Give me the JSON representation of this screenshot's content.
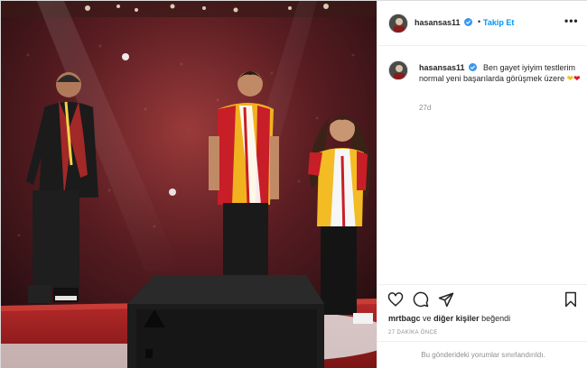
{
  "post": {
    "photo_alt": "hasansas11 post photo",
    "header": {
      "username": "hasansas11",
      "dot": "•",
      "follow_label": "Takip Et",
      "more_label": "•••"
    },
    "caption": {
      "username": "hasansas11",
      "text": "Ben gayet iyiyim testlerim normal yeni başarılarda görüşmek üzere",
      "hearts": [
        "yellow-heart",
        "red-heart"
      ],
      "age": "27d"
    },
    "likes": {
      "user": "mrtbagc",
      "connector": "ve",
      "others": "diğer kişiler",
      "suffix": "beğendi"
    },
    "timestamp": "27 DAKİKA ÖNCE",
    "comments_limited": "Bu gönderideki yorumlar sınırlandırıldı.",
    "icons": [
      "heart-icon",
      "comment-icon",
      "share-icon",
      "bookmark-icon",
      "verified-badge-icon"
    ],
    "colors": {
      "accent": "#0095f6",
      "verified": "#3897f0",
      "text": "#262626",
      "muted": "#8e8e8e",
      "border": "#efefef"
    }
  }
}
